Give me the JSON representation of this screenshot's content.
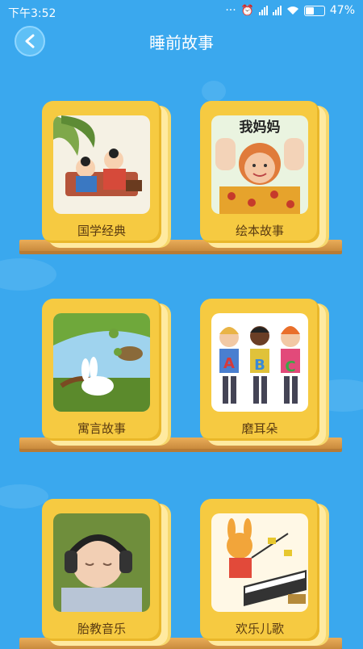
{
  "status": {
    "time": "下午3:52",
    "battery": "47%"
  },
  "header": {
    "title": "睡前故事"
  },
  "books": [
    {
      "label": "国学经典"
    },
    {
      "label": "绘本故事",
      "cover_text": "我妈妈"
    },
    {
      "label": "寓言故事"
    },
    {
      "label": "磨耳朵",
      "cover_letters": [
        "A",
        "B",
        "C"
      ]
    },
    {
      "label": "胎教音乐"
    },
    {
      "label": "欢乐儿歌"
    }
  ],
  "colors": {
    "background": "#3aa8ee",
    "book": "#f6ca41",
    "shelf": "#e9ad5a"
  }
}
